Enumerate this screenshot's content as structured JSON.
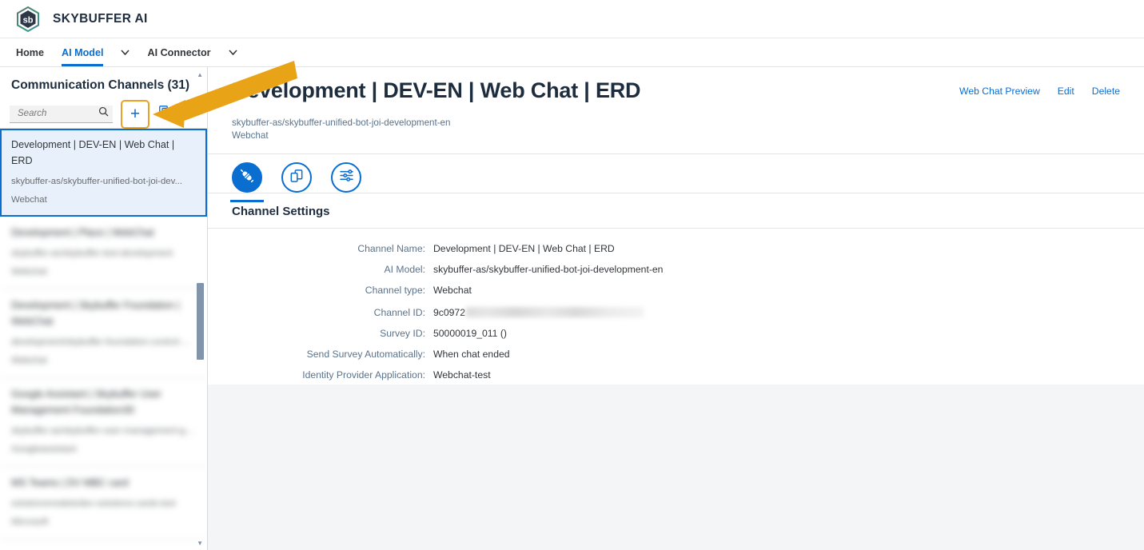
{
  "app": {
    "brand": "SKYBUFFER AI",
    "logo_text": "sb",
    "logo_icon": "hexagon-logo-icon"
  },
  "nav": {
    "items": [
      {
        "label": "Home",
        "active": false,
        "caret": false
      },
      {
        "label": "AI Model",
        "active": true,
        "caret": true
      },
      {
        "label": "AI Connector",
        "active": false,
        "caret": true
      }
    ],
    "caret_glyph": "∨"
  },
  "sidebar": {
    "title": "Communication Channels (31)",
    "search": {
      "placeholder": "Search",
      "value": "",
      "icon": "search-icon"
    },
    "tools": [
      {
        "name": "add-channel-button",
        "icon": "plus-icon",
        "glyph": "+",
        "highlighted": true
      },
      {
        "name": "copy-channel-button",
        "icon": "copy-icon"
      },
      {
        "name": "filter-button",
        "icon": "filter-icon"
      }
    ],
    "items": [
      {
        "title": "Development | DEV-EN | Web Chat | ERD",
        "model": "skybuffer-as/skybuffer-unified-bot-joi-dev...",
        "type": "Webchat",
        "selected": true,
        "blurred": false
      },
      {
        "title": "Development | Place | WebChat",
        "model": "skybuffer-as/skybuffer-test-development",
        "type": "Webchat",
        "selected": false,
        "blurred": true
      },
      {
        "title": "Development | Skybuffer Foundation | WebChat",
        "model": "development/skybuffer-foundation-control-webchat",
        "type": "Webchat",
        "selected": false,
        "blurred": true
      },
      {
        "title": "Google Assistant | Skybuffer User Management Foundation30",
        "model": "skybuffer-as/skybuffer-user-management-googleassistant",
        "type": "Googleassistant",
        "selected": false,
        "blurred": true
      },
      {
        "title": "MS Teams | DV MBC card",
        "model": "solutionsmodels/dev-solutions-cards-test",
        "type": "Microsoft",
        "selected": false,
        "blurred": true
      }
    ],
    "scrollbar": {
      "name": "channel-list-scrollbar"
    }
  },
  "main": {
    "title": "Development | DEV-EN | Web Chat | ERD",
    "subtitle_lines": [
      "skybuffer-as/skybuffer-unified-bot-joi-development-en",
      "Webchat"
    ],
    "actions": [
      {
        "label": "Web Chat Preview",
        "name": "web-chat-preview-link"
      },
      {
        "label": "Edit",
        "name": "edit-link"
      },
      {
        "label": "Delete",
        "name": "delete-link"
      }
    ],
    "icon_tabs": [
      {
        "name": "tab-channel-settings",
        "icon": "connector-plug-icon",
        "active": true
      },
      {
        "name": "tab-devices",
        "icon": "devices-icon",
        "active": false
      },
      {
        "name": "tab-advanced-settings",
        "icon": "sliders-settings-icon",
        "active": false
      }
    ],
    "section_title": "Channel Settings",
    "fields": [
      {
        "label": "Channel Name:",
        "value": "Development | DEV-EN | Web Chat | ERD",
        "redacted": false
      },
      {
        "label": "AI Model:",
        "value": "skybuffer-as/skybuffer-unified-bot-joi-development-en",
        "redacted": false
      },
      {
        "label": "Channel type:",
        "value": "Webchat",
        "redacted": false
      },
      {
        "label": "Channel ID:",
        "value": "9c0972",
        "redacted": true
      },
      {
        "label": "Survey ID:",
        "value": "50000019_011 ()",
        "redacted": false
      },
      {
        "label": "Send Survey Automatically:",
        "value": "When chat ended",
        "redacted": false
      },
      {
        "label": "Identity Provider Application:",
        "value": "Webchat-test",
        "redacted": false
      }
    ]
  },
  "annotation": {
    "arrow_color": "#e8a317",
    "arrow_name": "callout-arrow"
  },
  "colors": {
    "accent": "#0a6ed1",
    "title": "#1d2d3e",
    "label": "#5b738b",
    "highlight": "#e9a227",
    "page_bg": "#f4f5f7"
  }
}
